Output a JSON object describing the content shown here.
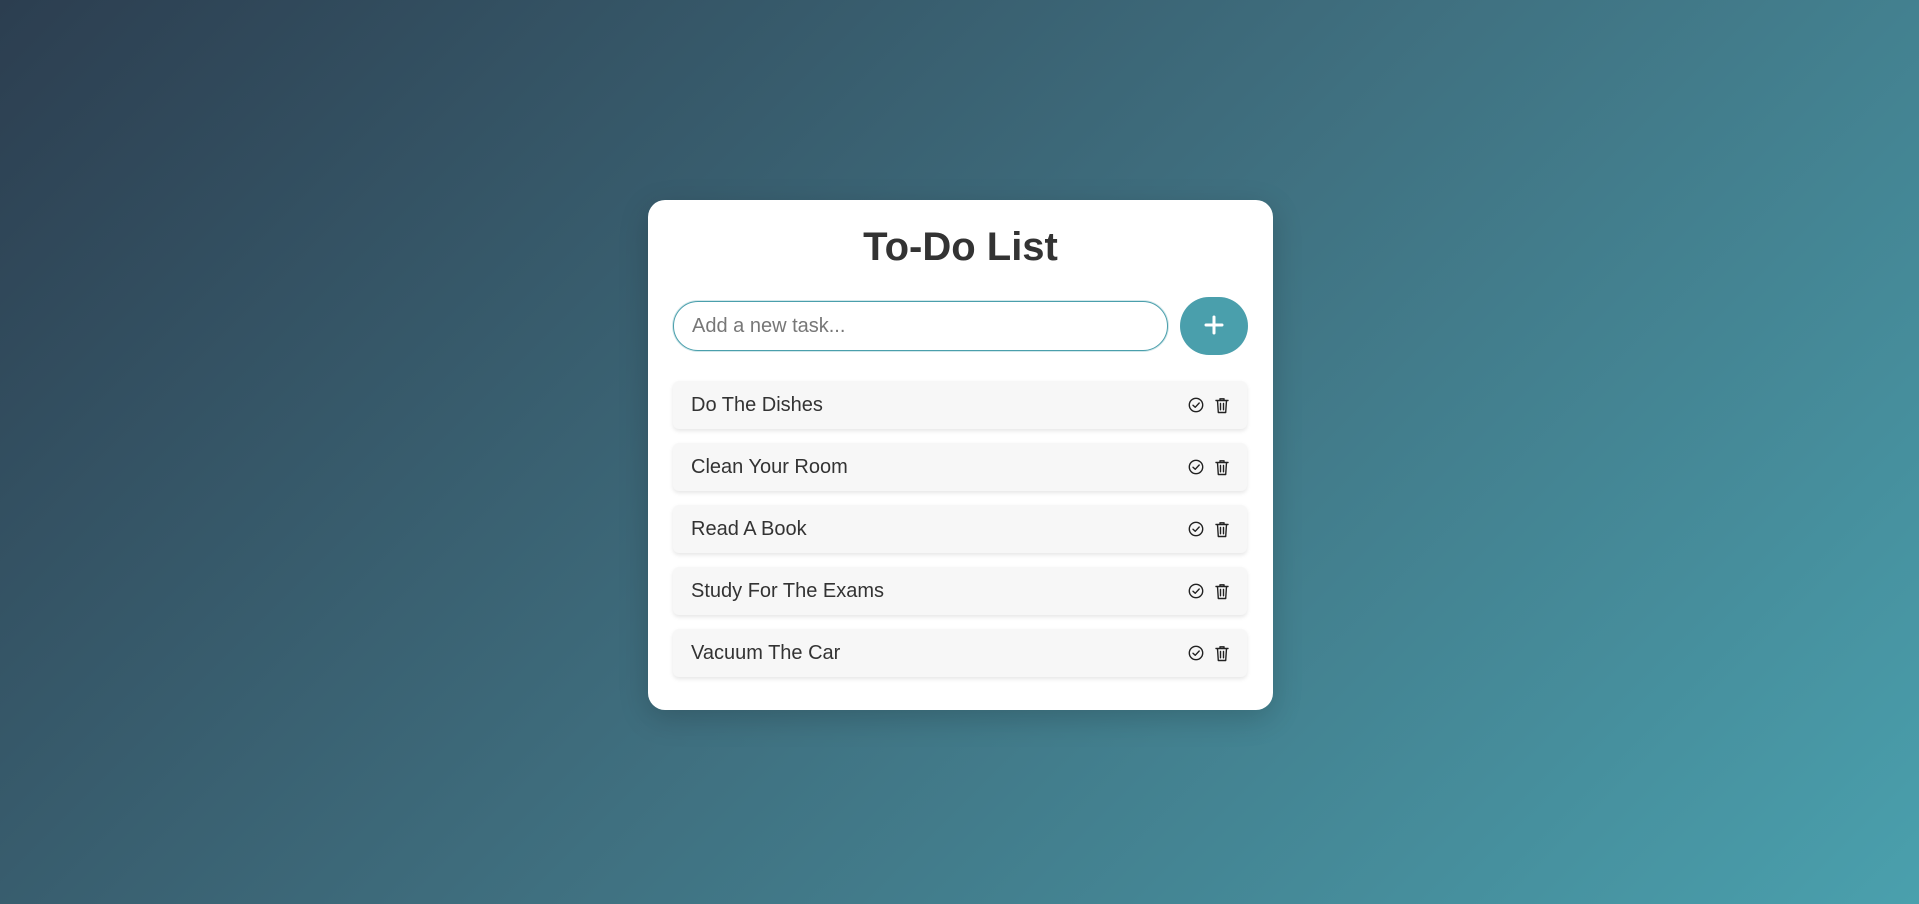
{
  "app": {
    "title": "To-Do List"
  },
  "input": {
    "placeholder": "Add a new task...",
    "value": ""
  },
  "add_button": {
    "icon": "plus-icon",
    "label": "+"
  },
  "tasks": [
    {
      "text": "Do The Dishes",
      "complete_icon": "check-circle-icon",
      "delete_icon": "trash-icon"
    },
    {
      "text": "Clean Your Room",
      "complete_icon": "check-circle-icon",
      "delete_icon": "trash-icon"
    },
    {
      "text": "Read A Book",
      "complete_icon": "check-circle-icon",
      "delete_icon": "trash-icon"
    },
    {
      "text": "Study For The Exams",
      "complete_icon": "check-circle-icon",
      "delete_icon": "trash-icon"
    },
    {
      "text": "Vacuum The Car",
      "complete_icon": "check-circle-icon",
      "delete_icon": "trash-icon"
    }
  ],
  "colors": {
    "accent": "#4a9fac",
    "background_start": "#2c3e50",
    "background_end": "#4aa0ad",
    "card": "#ffffff",
    "task_background": "#f7f7f7",
    "text": "#333333"
  }
}
